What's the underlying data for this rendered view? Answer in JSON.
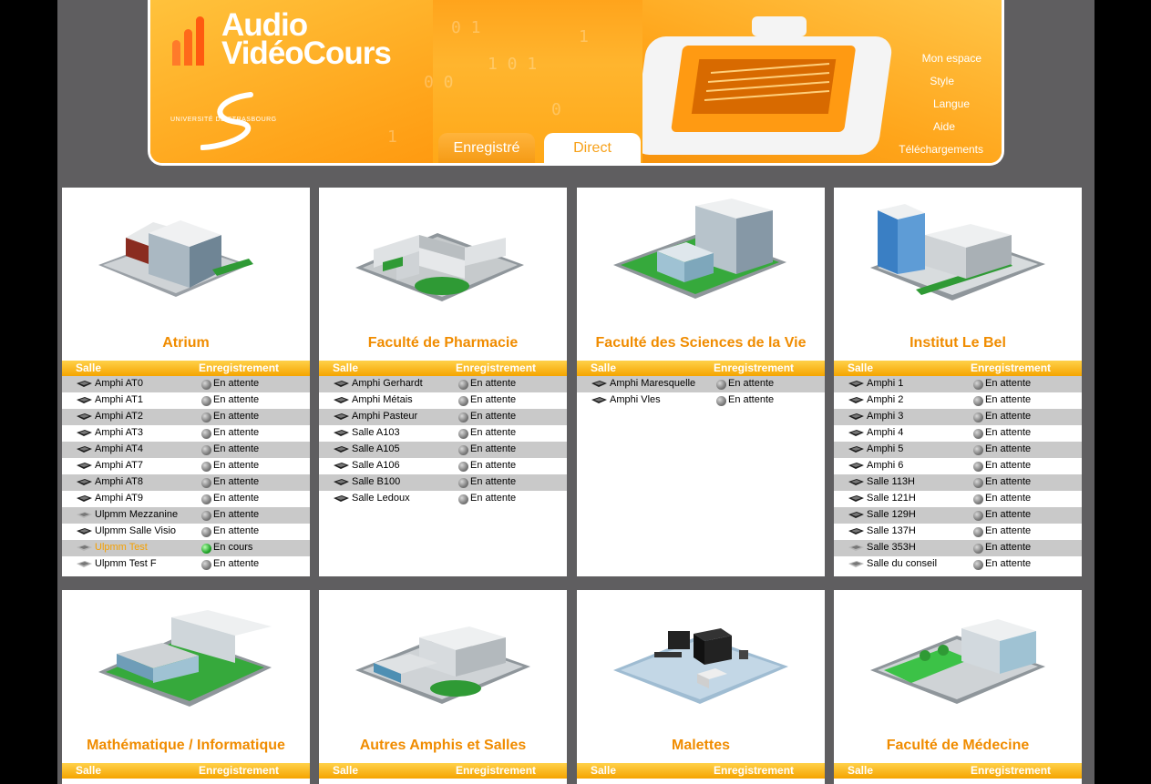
{
  "header": {
    "logo_line1": "Audio",
    "logo_line2": "VidéoCours",
    "university": "UNIVERSITÉ DE STRASBOURG",
    "tabs": [
      {
        "label": "Enregistré"
      },
      {
        "label": "Direct"
      }
    ],
    "menu": [
      "Mon espace",
      "Style",
      "Langue",
      "Aide",
      "Téléchargements"
    ]
  },
  "table_headers": {
    "room": "Salle",
    "recording": "Enregistrement"
  },
  "colors": {
    "accent": "#f08c00",
    "live": "#22a52a",
    "idle": "#7a7a7a"
  },
  "buildings": [
    {
      "name": "Atrium",
      "rooms": [
        {
          "name": "Amphi AT0",
          "status": "En attente"
        },
        {
          "name": "Amphi AT1",
          "status": "En attente"
        },
        {
          "name": "Amphi AT2",
          "status": "En attente"
        },
        {
          "name": "Amphi AT3",
          "status": "En attente"
        },
        {
          "name": "Amphi AT4",
          "status": "En attente"
        },
        {
          "name": "Amphi AT7",
          "status": "En attente"
        },
        {
          "name": "Amphi AT8",
          "status": "En attente"
        },
        {
          "name": "Amphi AT9",
          "status": "En attente"
        },
        {
          "name": "Ulpmm Mezzanine",
          "status": "En attente"
        },
        {
          "name": "Ulpmm Salle Visio",
          "status": "En attente"
        },
        {
          "name": "Ulpmm Test",
          "status": "En cours"
        },
        {
          "name": "Ulpmm Test F",
          "status": "En attente"
        }
      ]
    },
    {
      "name": "Faculté de Pharmacie",
      "rooms": [
        {
          "name": "Amphi Gerhardt",
          "status": "En attente"
        },
        {
          "name": "Amphi Métais",
          "status": "En attente"
        },
        {
          "name": "Amphi Pasteur",
          "status": "En attente"
        },
        {
          "name": "Salle A103",
          "status": "En attente"
        },
        {
          "name": "Salle A105",
          "status": "En attente"
        },
        {
          "name": "Salle A106",
          "status": "En attente"
        },
        {
          "name": "Salle B100",
          "status": "En attente"
        },
        {
          "name": "Salle Ledoux",
          "status": "En attente"
        }
      ]
    },
    {
      "name": "Faculté des Sciences de la Vie",
      "rooms": [
        {
          "name": "Amphi Maresquelle",
          "status": "En attente"
        },
        {
          "name": "Amphi Vles",
          "status": "En attente"
        }
      ]
    },
    {
      "name": "Institut Le Bel",
      "rooms": [
        {
          "name": "Amphi 1",
          "status": "En attente"
        },
        {
          "name": "Amphi 2",
          "status": "En attente"
        },
        {
          "name": "Amphi 3",
          "status": "En attente"
        },
        {
          "name": "Amphi 4",
          "status": "En attente"
        },
        {
          "name": "Amphi 5",
          "status": "En attente"
        },
        {
          "name": "Amphi 6",
          "status": "En attente"
        },
        {
          "name": "Salle 113H",
          "status": "En attente"
        },
        {
          "name": "Salle 121H",
          "status": "En attente"
        },
        {
          "name": "Salle 129H",
          "status": "En attente"
        },
        {
          "name": "Salle 137H",
          "status": "En attente"
        },
        {
          "name": "Salle 353H",
          "status": "En attente"
        },
        {
          "name": "Salle du conseil",
          "status": "En attente"
        }
      ]
    },
    {
      "name": "Mathématique / Informatique",
      "rooms": []
    },
    {
      "name": "Autres Amphis et Salles",
      "rooms": []
    },
    {
      "name": "Malettes",
      "rooms": []
    },
    {
      "name": "Faculté de Médecine",
      "rooms": []
    }
  ]
}
